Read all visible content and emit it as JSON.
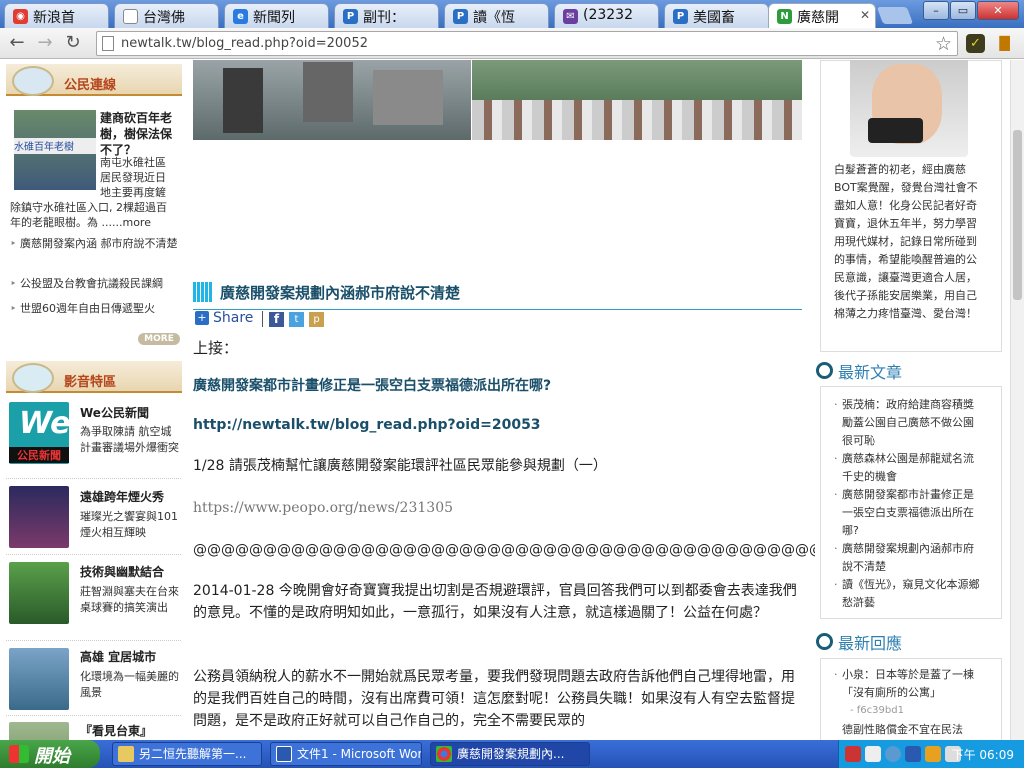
{
  "browser": {
    "tabs": [
      {
        "label": "新浪首",
        "icon": "weibo-icon",
        "color": "#e23b2f"
      },
      {
        "label": "台灣佛",
        "icon": "page-icon",
        "color": "#ffffff"
      },
      {
        "label": "新聞列",
        "icon": "ie-icon",
        "color": "#2a7be0"
      },
      {
        "label": "副刊：",
        "icon": "p-icon",
        "color": "#2a6fc4"
      },
      {
        "label": "讀《恆",
        "icon": "p-icon",
        "color": "#2a6fc4"
      },
      {
        "label": "(23232",
        "icon": "mail-icon",
        "color": "#6b3fa0"
      },
      {
        "label": "美國畜",
        "icon": "p-icon",
        "color": "#2a6fc4"
      },
      {
        "label": "廣慈開",
        "icon": "newtalk-icon",
        "color": "#2e9c3c",
        "active": true
      }
    ],
    "window_buttons": [
      "–",
      "▭",
      "✕"
    ],
    "address": "newtalk.tw/blog_read.php?oid=20052"
  },
  "left": {
    "citizen": {
      "title": "公民連線",
      "headline": "建商砍百年老樹，樹保法保不了？",
      "summary_lines": [
        "南屯水碓社區",
        "居民發現近日",
        "地主要再度鏟",
        "除鎮守水碓社區入口, 2棵超過百",
        "年的老龍眼樹。為 ......more"
      ],
      "links": [
        "廣慈開發案內涵 郝市府說不清楚",
        "公投盟及台教會抗議殺民課綱",
        "世盟60週年自由日傳遞聖火"
      ],
      "more": "MORE"
    },
    "video": {
      "title": "影音特區",
      "items": [
        {
          "title": "We公民新聞",
          "desc": "為爭取陳請 航空城計畫審議場外爆衝突",
          "thumb_text": "公民新聞",
          "color": "#1b9fa8"
        },
        {
          "title": "遠雄跨年煙火秀",
          "desc": "璀璨光之饗宴與101煙火相互輝映",
          "color": "#3a3470"
        },
        {
          "title": "技術與幽默結合",
          "desc": "莊智淵與塞夫在台來桌球賽的搞笑演出",
          "color": "#3b7a3a"
        },
        {
          "title": "高雄 宜居城市",
          "desc": "化環境為一幅美麗的風景",
          "color": "#5a8bb0"
        },
        {
          "title": "『看見台東』",
          "desc": "",
          "color": "#7a9a5a"
        }
      ]
    }
  },
  "article": {
    "caption": "廣慈開發案規劃內涵郝市府說不清楚",
    "share": "Share",
    "opening": "上接：",
    "link_title": "廣慈開發案都市計畫修正是一張空白支票福德派出所在哪?",
    "link_url": "http://newtalk.tw/blog_read.php?oid=20053",
    "note_line": "1/28 請張茂楠幫忙讓廣慈開發案能環評社區民眾能參與規劃（一）",
    "peopo_url": "https://www.peopo.org/news/231305",
    "divider": "@@@@@@@@@@@@@@@@@@@@@@@@@@@@@@@@@@@@@@@@@@@@@@@@@",
    "para1": "2014-01-28 今晚開會好奇寶寶我提出切割是否規避環評，官員回答我們可以到都委會去表達我們的意見。不懂的是政府明知如此，一意孤行，如果沒有人注意，就這樣過關了！公益在何處？",
    "para2": "公務員領納稅人的薪水不一開始就爲民眾考量，要我們發現問題去政府告訴他們自己埋得地雷，用的是我們百姓自己的時間，沒有出席費可領！這怎麼對呢！公務員失職！如果沒有人有空去監督提問題，是不是政府正好就可以自己作自己的，完全不需要民眾的"
  },
  "right": {
    "bio": "白髮蒼蒼的初老，經由廣慈BOT案覺醒，發覺台灣社會不盡如人意！化身公民記者好奇寶寶，退休五年半，努力學習用現代媒材，記錄日常所碰到的事情，希望能喚醒普遍的公民意識，讓臺灣更適合人居，後代子孫能安居樂業，用自己棉薄之力疼惜臺灣、愛台灣！",
    "latest_title": "最新文章",
    "latest": [
      "張茂楠：政府給建商容積獎勵蓋公園自己廣慈不做公園很可恥",
      "廣慈森林公園是郝龍斌名流千史的機會",
      "廣慈開發案都市計畫修正是一張空白支票福德派出所在哪?",
      "廣慈開發案規劃內涵郝市府說不清楚",
      "讀《恆光》，窺見文化本源鄉愁滸藝"
    ],
    "replies_title": "最新回應",
    "replies": [
      {
        "text": "小泉：日本等於是蓋了一棟「沒有廁所的公寓」",
        "id": "- f6c39bd1"
      },
      {
        "text": "德副性賂償金不宜在民法",
        "id": ""
      }
    ]
  },
  "taskbar": {
    "start": "開始",
    "tasks": [
      {
        "label": "另二恒先聽解第一...",
        "icon": "folder-icon"
      },
      {
        "label": "文件1 - Microsoft Word",
        "icon": "word-icon"
      },
      {
        "label": "廣慈開發案規劃內...",
        "icon": "chrome-icon",
        "active": true
      }
    ],
    "clock": "下午 06:09"
  }
}
